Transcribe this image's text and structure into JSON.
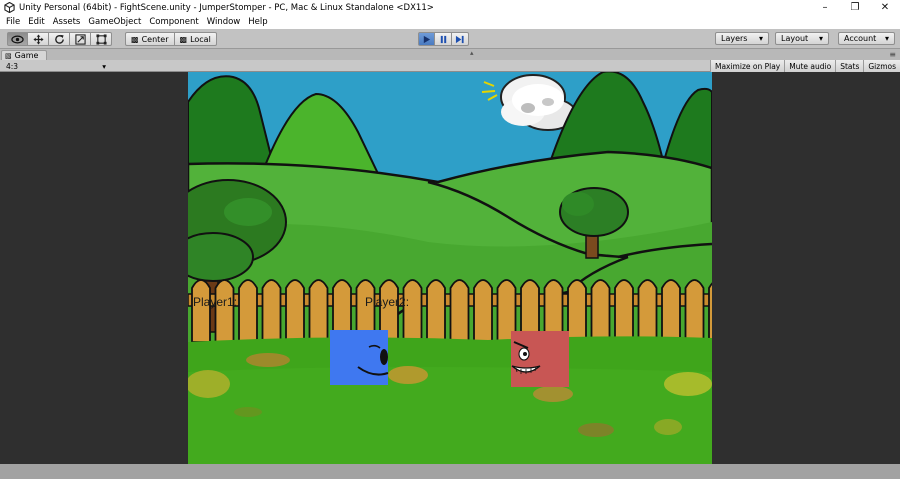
{
  "window": {
    "title": "Unity Personal (64bit) - FightScene.unity - JumperStomper - PC, Mac & Linux Standalone <DX11>",
    "buttons": {
      "minimize": "–",
      "maximize": "❐",
      "close": "✕"
    }
  },
  "menu": {
    "items": [
      "File",
      "Edit",
      "Assets",
      "GameObject",
      "Component",
      "Window",
      "Help"
    ]
  },
  "toolbar": {
    "tools": [
      {
        "name": "hand-tool",
        "icon": "eye-icon",
        "active": true
      },
      {
        "name": "move-tool",
        "icon": "move-arrows-icon",
        "active": false
      },
      {
        "name": "rotate-tool",
        "icon": "rotate-icon",
        "active": false
      },
      {
        "name": "scale-tool",
        "icon": "scale-icon",
        "active": false
      },
      {
        "name": "rect-tool",
        "icon": "rect-icon",
        "active": false
      }
    ],
    "pivot": {
      "center_label": "Center",
      "local_label": "Local"
    },
    "playback": {
      "play_active": true,
      "pause_active": false
    },
    "layers_label": "Layers",
    "layout_label": "Layout",
    "account_label": "Account"
  },
  "game_tab": {
    "label": "Game",
    "aspect": "4:3",
    "toggles": [
      "Maximize on Play",
      "Mute audio",
      "Stats",
      "Gizmos"
    ]
  },
  "scene": {
    "player1_label": "Player1:",
    "player2_label": "Player2:",
    "colors": {
      "sky": "#2e9fc8",
      "grass": "#3fa51b",
      "fence": "#d49a3a",
      "player1": "#3f78f0",
      "player2": "#c85654"
    }
  }
}
